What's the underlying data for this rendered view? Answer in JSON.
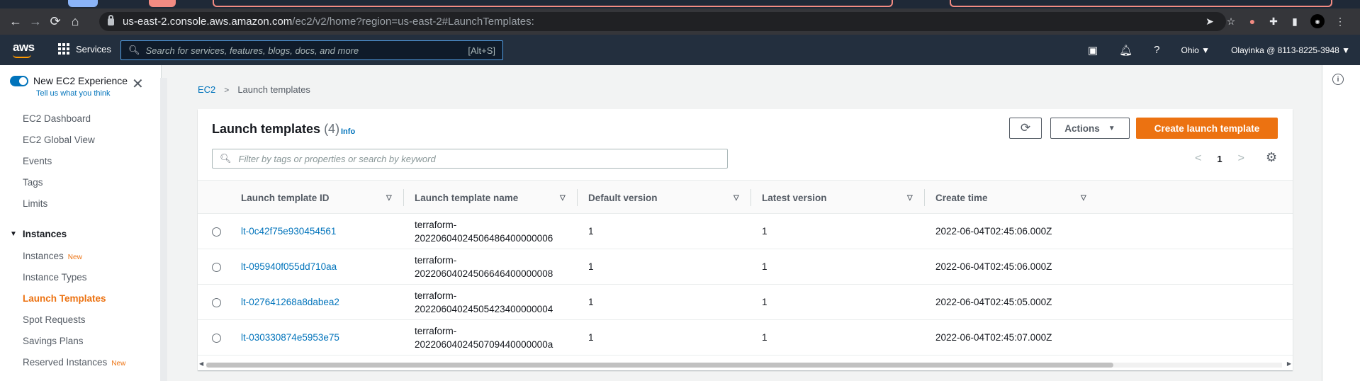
{
  "browser": {
    "url_host": "us-east-2.console.aws.amazon.com",
    "url_path": "/ec2/v2/home?region=us-east-2#LaunchTemplates:"
  },
  "aws_nav": {
    "logo": "aws",
    "services_label": "Services",
    "search_placeholder": "Search for services, features, blogs, docs, and more",
    "search_shortcut": "[Alt+S]",
    "region": "Ohio ▼",
    "account": "Olayinka @ 8113-8225-3948 ▼"
  },
  "sidebar": {
    "experience_title": "New EC2 Experience",
    "experience_link": "Tell us what you think",
    "items": [
      {
        "label": "EC2 Dashboard"
      },
      {
        "label": "EC2 Global View"
      },
      {
        "label": "Events"
      },
      {
        "label": "Tags"
      },
      {
        "label": "Limits"
      }
    ],
    "section": "Instances",
    "section_items": [
      {
        "label": "Instances",
        "badge": "New"
      },
      {
        "label": "Instance Types"
      },
      {
        "label": "Launch Templates"
      },
      {
        "label": "Spot Requests"
      },
      {
        "label": "Savings Plans"
      },
      {
        "label": "Reserved Instances",
        "badge": "New"
      }
    ]
  },
  "breadcrumb": {
    "root": "EC2",
    "current": "Launch templates"
  },
  "panel": {
    "title": "Launch templates",
    "count": "(4)",
    "info": "Info",
    "actions_label": "Actions",
    "create_label": "Create launch template",
    "filter_placeholder": "Filter by tags or properties or search by keyword",
    "page": "1"
  },
  "table": {
    "columns": [
      "Launch template ID",
      "Launch template name",
      "Default version",
      "Latest version",
      "Create time"
    ],
    "rows": [
      {
        "id": "lt-0c42f75e930454561",
        "name1": "terraform-",
        "name2": "20220604024506486400000006",
        "default": "1",
        "latest": "1",
        "created": "2022-06-04T02:45:06.000Z"
      },
      {
        "id": "lt-095940f055dd710aa",
        "name1": "terraform-",
        "name2": "20220604024506646400000008",
        "default": "1",
        "latest": "1",
        "created": "2022-06-04T02:45:06.000Z"
      },
      {
        "id": "lt-027641268a8dabea2",
        "name1": "terraform-",
        "name2": "20220604024505423400000004",
        "default": "1",
        "latest": "1",
        "created": "2022-06-04T02:45:05.000Z"
      },
      {
        "id": "lt-030330874e5953e75",
        "name1": "terraform-",
        "name2": "2022060402450709440000000a",
        "default": "1",
        "latest": "1",
        "created": "2022-06-04T02:45:07.000Z"
      }
    ]
  },
  "colors": {
    "aws_nav_bg": "#232f3e",
    "accent_orange": "#ec7211",
    "link_blue": "#0073bb"
  }
}
